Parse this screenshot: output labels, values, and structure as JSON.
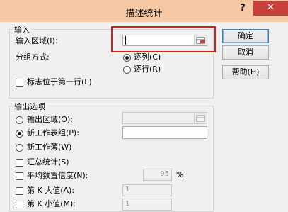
{
  "window": {
    "title": "描述统计",
    "help_glyph": "?",
    "close_glyph": "✕"
  },
  "input_group": {
    "title": "输入",
    "input_range_label": "输入区域(I):",
    "input_range_value": "",
    "grouped_by_label": "分组方式:",
    "by_columns_label": "逐列(C)",
    "by_rows_label": "逐行(R)",
    "labels_first_row_label": "标志位于第一行(L)"
  },
  "buttons": {
    "ok": "确定",
    "cancel": "取消",
    "help": "帮助(H)"
  },
  "output_group": {
    "title": "输出选项",
    "output_range_label": "输出区域(O):",
    "new_worksheet_label": "新工作表组(P):",
    "new_workbook_label": "新工作薄(W)",
    "summary_stats_label": "汇总统计(S)",
    "confidence_label": "平均数置信度(N):",
    "confidence_value": "95",
    "percent_sign": "%",
    "kth_largest_label": "第 K 大值(A):",
    "kth_largest_value": "1",
    "kth_smallest_label": "第 K 小值(M):",
    "kth_smallest_value": "1"
  },
  "selections": {
    "grouped_by": "columns",
    "output": "new_worksheet"
  },
  "colors": {
    "title_bar": "#f6c9a4",
    "close_button": "#c7403a",
    "highlight": "#d0211c"
  }
}
